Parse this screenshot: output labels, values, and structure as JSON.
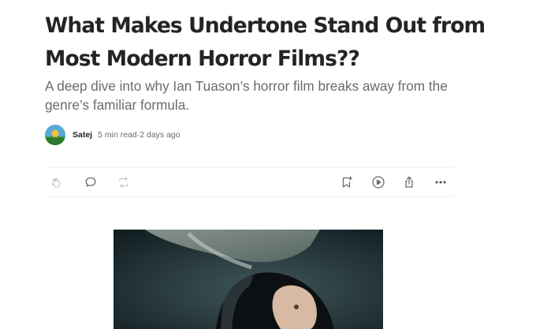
{
  "article": {
    "title": "What Makes Undertone Stand Out from Most Modern Horror Films??",
    "subtitle": "A deep dive into why Ian Tuason’s horror film breaks away from the genre’s familiar formula."
  },
  "byline": {
    "author": "Satej",
    "read_time": "5 min read",
    "separator": "·",
    "published": "2 days ago"
  },
  "actions": {
    "icons": [
      "clap-icon",
      "comment-icon",
      "repost-icon",
      "bookmark-icon",
      "play-icon",
      "share-icon",
      "more-icon"
    ]
  },
  "colors": {
    "text": "#242424",
    "muted": "#6b6b6b",
    "icon": "#6b6b6b",
    "divider": "#f2f2f2"
  }
}
